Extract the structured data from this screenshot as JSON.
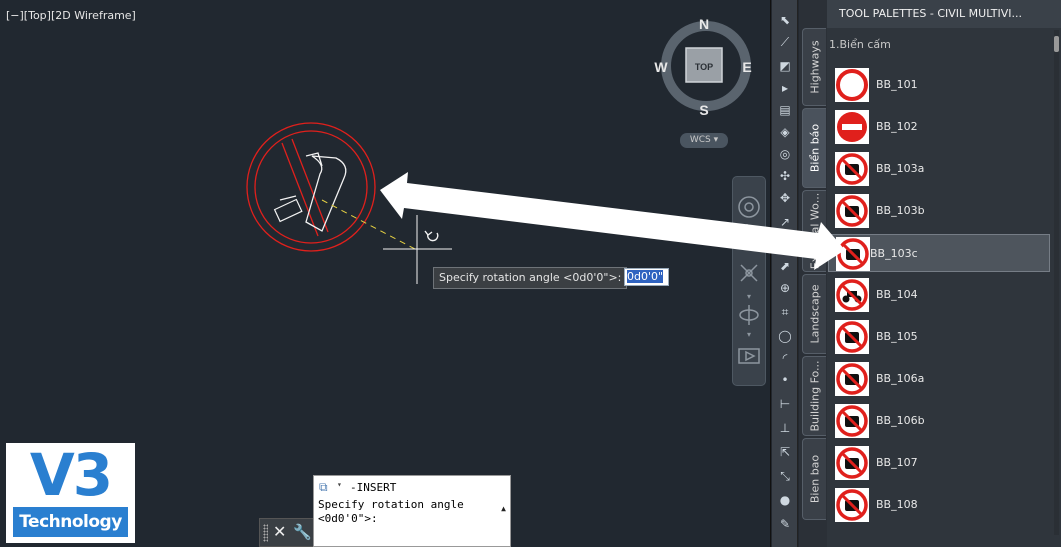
{
  "viewport": {
    "label": "[−][Top][2D Wireframe]",
    "viewcube": {
      "north": "N",
      "south": "S",
      "east": "E",
      "west": "W",
      "face": "TOP"
    },
    "ucs": "WCS"
  },
  "drawing": {
    "tooltip": "Specify rotation angle <0d0'0\">:",
    "input_value": "0d0'0\""
  },
  "logo": {
    "main": "V3",
    "sub": "Technology"
  },
  "command": {
    "title": "-INSERT",
    "prompt_line1": "Specify rotation angle",
    "prompt_line2": "<0d0'0\">:"
  },
  "tabs": [
    {
      "label": "Highways"
    },
    {
      "label": "Biển báo"
    },
    {
      "label": "External Wo..."
    },
    {
      "label": "Landscape"
    },
    {
      "label": "Building Fo..."
    },
    {
      "label": "Bien bao"
    }
  ],
  "palette": {
    "title": "TOOL PALETTES - CIVIL MULTIVI...",
    "section": "1.Biển cấm",
    "items": [
      {
        "label": "BB_101",
        "icon": "no-entry-both-icon"
      },
      {
        "label": "BB_102",
        "icon": "no-entry-icon"
      },
      {
        "label": "BB_103a",
        "icon": "no-cars-icon"
      },
      {
        "label": "BB_103b",
        "icon": "no-cars-turn-right-icon"
      },
      {
        "label": "BB_103c",
        "icon": "no-cars-turn-left-icon"
      },
      {
        "label": "BB_104",
        "icon": "no-motorbikes-icon"
      },
      {
        "label": "BB_105",
        "icon": "no-cars-and-motorbikes-icon"
      },
      {
        "label": "BB_106a",
        "icon": "no-trucks-icon"
      },
      {
        "label": "BB_106b",
        "icon": "no-heavy-trucks-icon"
      },
      {
        "label": "BB_107",
        "icon": "no-buses-icon"
      },
      {
        "label": "BB_108",
        "icon": "no-trailers-icon"
      }
    ],
    "selected": "BB_103c"
  },
  "colors": {
    "sign_red": "#e0201c",
    "accent_blue": "#2a7fd0",
    "background": "#212830"
  }
}
